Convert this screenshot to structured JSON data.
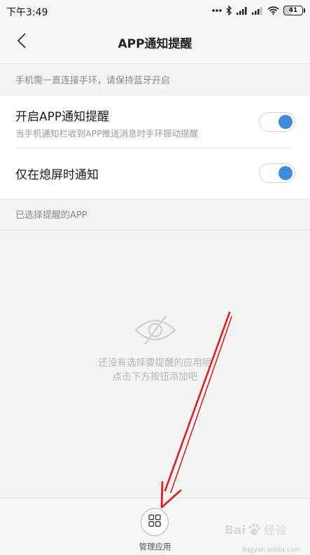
{
  "status_bar": {
    "time": "下午3:49",
    "battery_level": "41",
    "icons": [
      "dots-icon",
      "bluetooth-icon",
      "signal-icon",
      "signal-icon",
      "wifi-icon",
      "battery-icon"
    ]
  },
  "header": {
    "title": "APP通知提醒",
    "back_icon": "chevron-left-icon"
  },
  "hint": "手机需一直连接手环，请保持蓝牙开启",
  "settings": [
    {
      "title": "开启APP通知提醒",
      "description": "当手机通知栏收到APP推送消息时手环振动提醒",
      "enabled": true
    },
    {
      "title": "仅在熄屏时通知",
      "enabled": true
    }
  ],
  "selected_section": {
    "header": "已选择提醒的APP",
    "empty_icon": "eye-off-icon",
    "empty_line1": "还没有选择要提醒的应用呢",
    "empty_line2": "点击下方按钮添加吧"
  },
  "bottom": {
    "manage_label": "管理应用",
    "manage_icon": "grid-icon"
  },
  "watermark": {
    "text": "Bai 经验",
    "sub": "jingyan.baidu.com"
  },
  "colors": {
    "toggle_on": "#3d8be0",
    "annotation_arrow": "#e02020"
  }
}
